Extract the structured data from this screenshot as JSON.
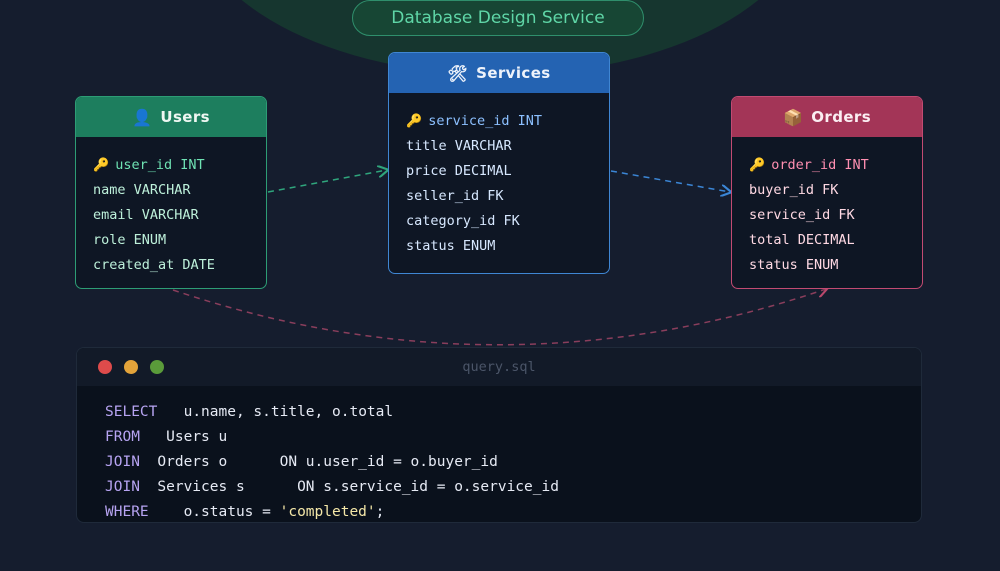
{
  "banner": {
    "title": "Database Design Service"
  },
  "colors": {
    "users": "#1d7e5e",
    "services": "#2463b2",
    "orders": "#a33557",
    "background": "#151d2e"
  },
  "tables": {
    "users": {
      "icon": "user-icon",
      "icon_glyph": "👤",
      "title": "Users",
      "columns": [
        {
          "key": true,
          "text": "user_id INT"
        },
        {
          "key": false,
          "text": "name VARCHAR"
        },
        {
          "key": false,
          "text": "email VARCHAR"
        },
        {
          "key": false,
          "text": "role ENUM"
        },
        {
          "key": false,
          "text": "created_at DATE"
        }
      ]
    },
    "services": {
      "icon": "tools-icon",
      "icon_glyph": "🛠",
      "title": "Services",
      "columns": [
        {
          "key": true,
          "text": "service_id INT"
        },
        {
          "key": false,
          "text": "title VARCHAR"
        },
        {
          "key": false,
          "text": "price DECIMAL"
        },
        {
          "key": false,
          "text": "seller_id FK"
        },
        {
          "key": false,
          "text": "category_id FK"
        },
        {
          "key": false,
          "text": "status ENUM"
        }
      ]
    },
    "orders": {
      "icon": "box-icon",
      "icon_glyph": "📦",
      "title": "Orders",
      "columns": [
        {
          "key": true,
          "text": "order_id INT"
        },
        {
          "key": false,
          "text": "buyer_id FK"
        },
        {
          "key": false,
          "text": "service_id FK"
        },
        {
          "key": false,
          "text": "total DECIMAL"
        },
        {
          "key": false,
          "text": "status ENUM"
        }
      ]
    }
  },
  "key_icon": "key-icon",
  "key_glyph": "🔑",
  "editor": {
    "filename": "query.sql",
    "lines": [
      {
        "kw": "SELECT",
        "gap": "   ",
        "text": "u.name, s.title, o.total"
      },
      {
        "kw": "FROM",
        "gap": "   ",
        "text": "Users u"
      },
      {
        "kw": "JOIN",
        "gap": "  ",
        "text": "Orders o      ON u.user_id = o.buyer_id"
      },
      {
        "kw": "JOIN",
        "gap": "  ",
        "text": "Services s      ON s.service_id = o.service_id"
      },
      {
        "kw": "WHERE",
        "gap": "    ",
        "text": "o.status = ",
        "str": "'completed'",
        "tail": ";"
      }
    ]
  }
}
